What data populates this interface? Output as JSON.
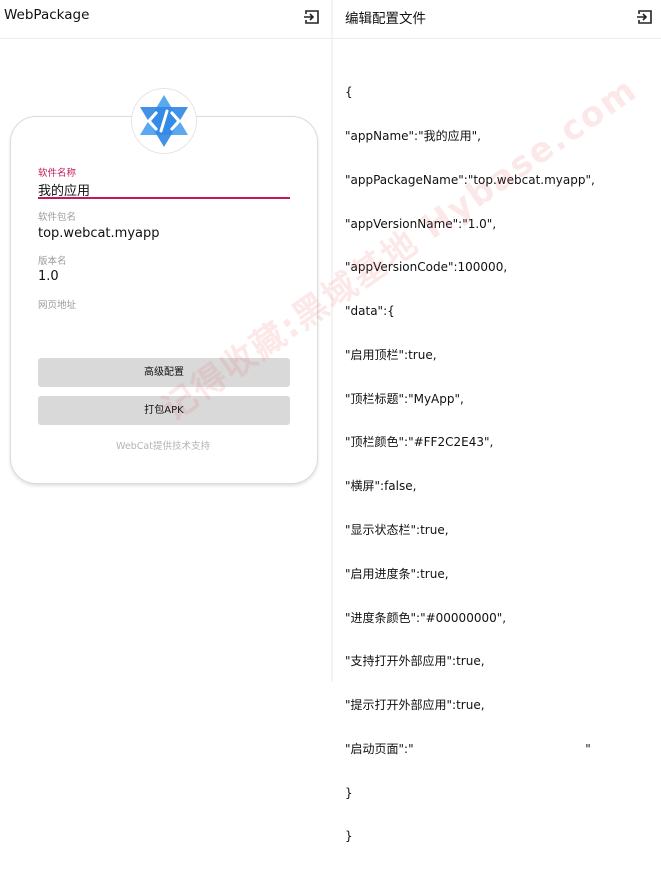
{
  "left": {
    "app_title": "WebPackage",
    "fields": [
      {
        "label": "软件名称",
        "value": "我的应用"
      },
      {
        "label": "软件包名",
        "value": "top.webcat.myapp"
      },
      {
        "label": "版本名",
        "value": "1.0"
      },
      {
        "label": "网页地址",
        "value": ""
      }
    ],
    "advanced_button": "高级配置",
    "build_button": "打包APK",
    "support_text": "WebCat提供技术支持"
  },
  "right": {
    "title": "编辑配置文件",
    "json_lines": [
      "{",
      "\"appName\":\"我的应用\",",
      "\"appPackageName\":\"top.webcat.myapp\",",
      "\"appVersionName\":\"1.0\",",
      "\"appVersionCode\":100000,",
      "\"data\":{",
      "\"启用顶栏\":true,",
      "\"顶栏标题\":\"MyApp\",",
      "\"顶栏颜色\":\"#FF2C2E43\",",
      "\"横屏\":false,",
      "\"显示状态栏\":true,",
      "\"启用进度条\":true,",
      "\"进度条颜色\":\"#00000000\",",
      "\"支持打开外部应用\":true,",
      "\"提示打开外部应用\":true,",
      "\"启动页面\":\"                                             \"",
      "}",
      "}"
    ]
  },
  "watermark": "记得收藏:黑域基地 Hybase.com",
  "colors": {
    "accent": "#c2185b",
    "button_bg": "#d9d9d9",
    "logo_blue": "#2f86e6"
  },
  "icons": {
    "exit": "exit-to-app-icon",
    "logo": "code-logo-icon"
  }
}
